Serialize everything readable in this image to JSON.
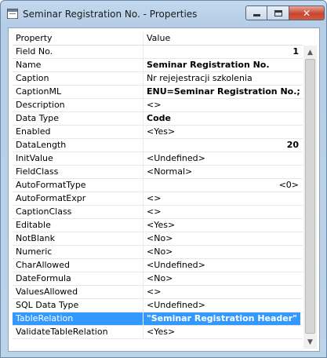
{
  "window": {
    "title": "Seminar Registration No. - Properties",
    "buttons": {
      "minimize": "minimize",
      "maximize": "maximize",
      "close": "✕"
    }
  },
  "table": {
    "columns": {
      "property": "Property",
      "value": "Value"
    },
    "rows": [
      {
        "name": "Field No.",
        "value": "1"
      },
      {
        "name": "Name",
        "value": "Seminar Registration No."
      },
      {
        "name": "Caption",
        "value": "Nr rejejestracji szkolenia"
      },
      {
        "name": "CaptionML",
        "value": "ENU=Seminar Registration No.;PL..."
      },
      {
        "name": "Description",
        "value": "<>"
      },
      {
        "name": "Data Type",
        "value": "Code"
      },
      {
        "name": "Enabled",
        "value": "<Yes>"
      },
      {
        "name": "DataLength",
        "value": "20"
      },
      {
        "name": "InitValue",
        "value": "<Undefined>"
      },
      {
        "name": "FieldClass",
        "value": "<Normal>"
      },
      {
        "name": "AutoFormatType",
        "value": "<0>"
      },
      {
        "name": "AutoFormatExpr",
        "value": "<>"
      },
      {
        "name": "CaptionClass",
        "value": "<>"
      },
      {
        "name": "Editable",
        "value": "<Yes>"
      },
      {
        "name": "NotBlank",
        "value": "<No>"
      },
      {
        "name": "Numeric",
        "value": "<No>"
      },
      {
        "name": "CharAllowed",
        "value": "<Undefined>"
      },
      {
        "name": "DateFormula",
        "value": "<No>"
      },
      {
        "name": "ValuesAllowed",
        "value": "<>"
      },
      {
        "name": "SQL Data Type",
        "value": "<Undefined>"
      },
      {
        "name": "TableRelation",
        "value": "\"Seminar Registration Header\""
      },
      {
        "name": "ValidateTableRelation",
        "value": "<Yes>"
      }
    ],
    "selected_row": "TableRelation"
  },
  "scrollbar": {
    "up_icon": "▲",
    "down_icon": "▼"
  },
  "colors": {
    "selection": "#3399ff",
    "title_gradient": "#c4d9ee",
    "close_button": "#c7452e"
  }
}
